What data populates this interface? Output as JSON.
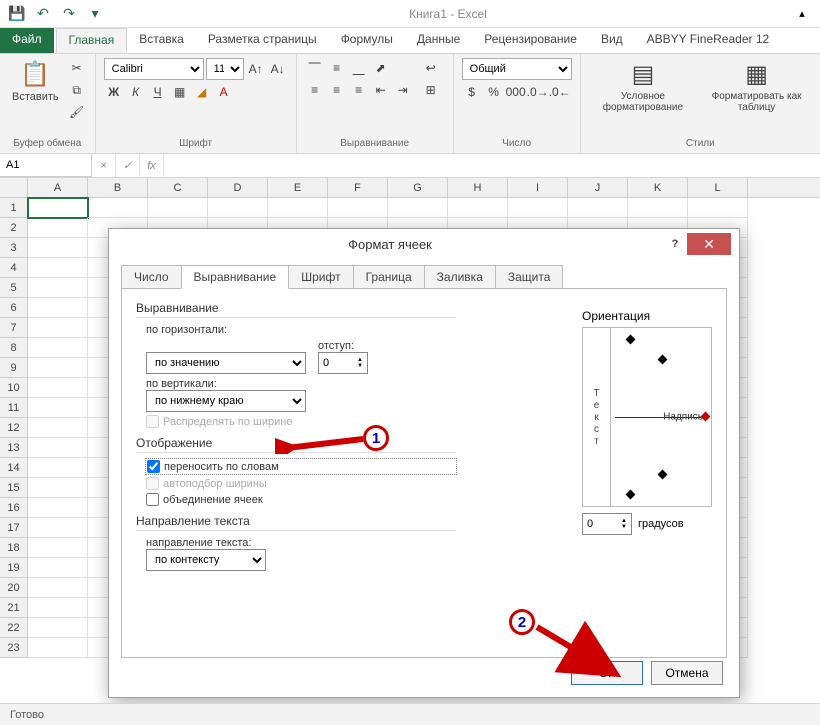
{
  "app": {
    "title": "Книга1 - Excel"
  },
  "qat": {
    "save": "💾",
    "undo": "↶",
    "redo": "↷"
  },
  "tabs": [
    "Файл",
    "Главная",
    "Вставка",
    "Разметка страницы",
    "Формулы",
    "Данные",
    "Рецензирование",
    "Вид",
    "ABBYY FineReader 12"
  ],
  "active_tab": "Главная",
  "ribbon": {
    "clipboard": {
      "label": "Буфер обмена",
      "paste": "Вставить"
    },
    "font": {
      "label": "Шрифт",
      "name": "Calibri",
      "size": "11",
      "bold": "Ж",
      "italic": "К",
      "underline": "Ч"
    },
    "align": {
      "label": "Выравнивание"
    },
    "number": {
      "label": "Число",
      "format": "Общий"
    },
    "styles": {
      "label": "Стили",
      "cond": "Условное форматирование",
      "table": "Форматировать как таблицу"
    }
  },
  "namebox": "A1",
  "cols": [
    "A",
    "B",
    "C",
    "D",
    "E",
    "F",
    "G",
    "H",
    "I",
    "J",
    "K",
    "L"
  ],
  "rows": [
    "1",
    "2",
    "3",
    "4",
    "5",
    "6",
    "7",
    "8",
    "9",
    "10",
    "11",
    "12",
    "13",
    "14",
    "15",
    "16",
    "17",
    "18",
    "19",
    "20",
    "21",
    "22",
    "23"
  ],
  "dialog": {
    "title": "Формат ячеек",
    "tabs": [
      "Число",
      "Выравнивание",
      "Шрифт",
      "Граница",
      "Заливка",
      "Защита"
    ],
    "active_tab": "Выравнивание",
    "sec_align": "Выравнивание",
    "lbl_horiz": "по горизонтали:",
    "val_horiz": "по значению",
    "lbl_indent": "отступ:",
    "val_indent": "0",
    "lbl_vert": "по вертикали:",
    "val_vert": "по нижнему краю",
    "chk_distribute": "Распределять по ширине",
    "sec_display": "Отображение",
    "chk_wrap": "переносить по словам",
    "chk_shrink": "автоподбор ширины",
    "chk_merge": "объединение ячеек",
    "sec_dir": "Направление текста",
    "lbl_dir": "направление текста:",
    "val_dir": "по контексту",
    "orient_label": "Ориентация",
    "orient_vtext": "Текст",
    "orient_nadpis": "Надпись",
    "deg_value": "0",
    "deg_label": "градусов",
    "ok": "ОК",
    "cancel": "Отмена"
  },
  "annot": {
    "n1": "1",
    "n2": "2"
  },
  "status": "Готово"
}
